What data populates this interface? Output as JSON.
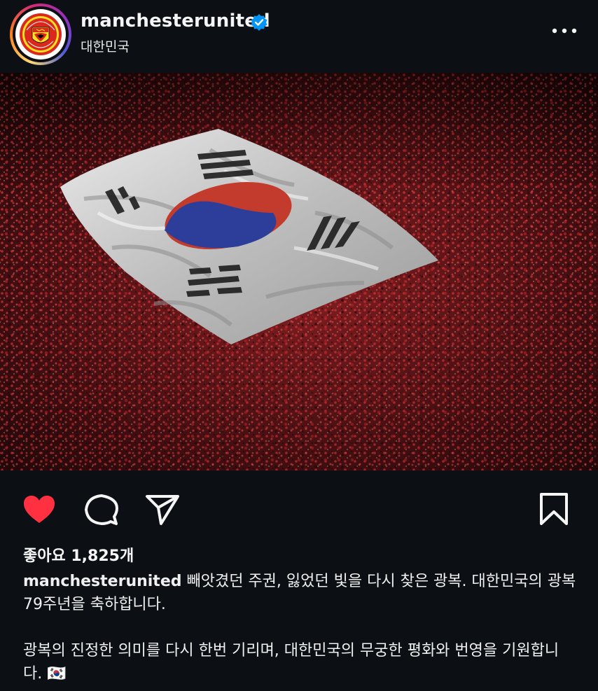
{
  "post": {
    "username": "manchesterunited",
    "location": "대한민국",
    "verified": true,
    "likes_text": "좋아요 1,825개",
    "caption_user": "manchesterunited",
    "caption_line1": " 빼앗겼던 주권, 잃었던 빛을 다시 찾은 광복. 대한민국의 광복 79주년을 축하합니다.",
    "caption_line2": "광복의 진정한 의미를 다시 한번 기리며, 대한민국의 무궁한 평화와 번영을 기원합니다. 🇰🇷"
  },
  "colors": {
    "background": "#0c1014",
    "like_red": "#ff3040",
    "verified_blue": "#0095f6",
    "text": "#f5f5f5"
  },
  "icons": {
    "like": "heart-icon",
    "comment": "comment-icon",
    "share": "send-icon",
    "save": "bookmark-icon",
    "more": "more-options-icon",
    "verified": "verified-badge-icon"
  }
}
